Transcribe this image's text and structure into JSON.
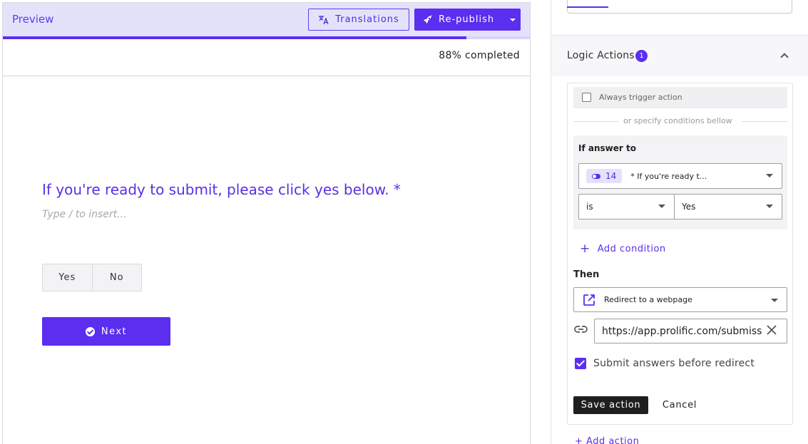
{
  "preview": {
    "title": "Preview",
    "translations_label": "Translations",
    "republish_label": "Re-publish",
    "progress_percent": 88,
    "progress_text": "88% completed",
    "question": "If you're ready to submit, please click yes below. *",
    "hint": "Type / to insert...",
    "choices": [
      "Yes",
      "No"
    ],
    "next_label": "Next"
  },
  "logic": {
    "title": "Logic Actions",
    "badge_count": "1",
    "always_trigger_label": "Always trigger action",
    "or_text": "or specify conditions bellow",
    "if_answer_label": "If answer to",
    "question_number": "14",
    "question_preview": "* If you're ready t...",
    "operator": "is",
    "value": "Yes",
    "add_condition_label": "Add condition",
    "then_label": "Then",
    "action_type": "Redirect to a webpage",
    "redirect_url": "https://app.prolific.com/submissions/complete",
    "submit_before_redirect_label": "Submit answers before redirect",
    "submit_before_redirect_checked": true,
    "save_label": "Save action",
    "cancel_label": "Cancel",
    "cutoff_label": "+ Add action"
  },
  "colors": {
    "accent": "#5b2ef0",
    "header_tint": "#e4e2fb"
  }
}
